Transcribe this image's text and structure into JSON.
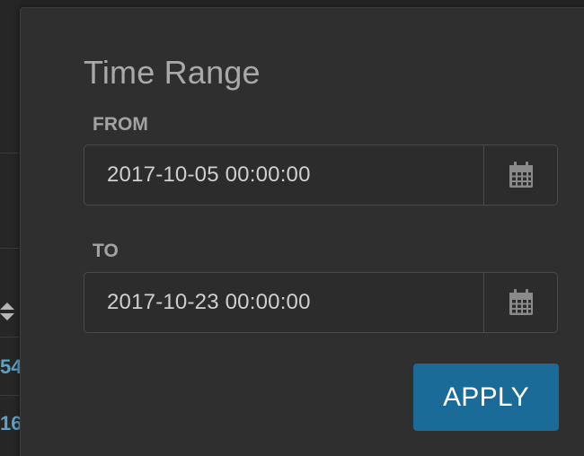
{
  "background_table": {
    "cells": [
      "54",
      "16"
    ],
    "sort_icon": "sort-icon"
  },
  "dialog": {
    "title": "Time Range",
    "from": {
      "label": "FROM",
      "value": "2017-10-05 00:00:00",
      "icon": "calendar-icon"
    },
    "to": {
      "label": "TO",
      "value": "2017-10-23 00:00:00",
      "icon": "calendar-icon"
    },
    "apply_label": "APPLY"
  },
  "colors": {
    "panel": "#2f2f2f",
    "accent": "#1b6b99",
    "link": "#5ea3c6"
  }
}
